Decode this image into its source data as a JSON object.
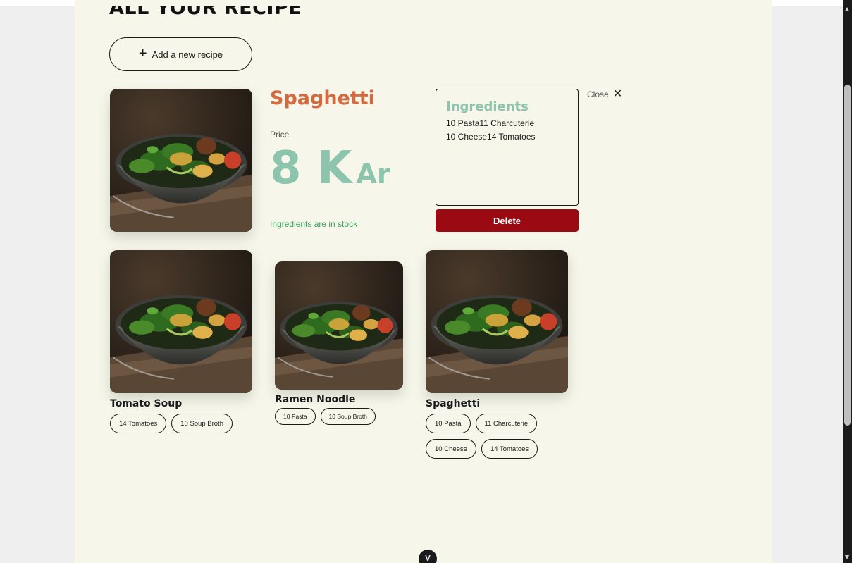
{
  "page": {
    "title": "ALL YOUR RECIPE",
    "add_button_label": "Add a new recipe",
    "add_button_icon": "plus-icon"
  },
  "detail": {
    "name": "Spaghetti",
    "price_label": "Price",
    "price_value": "8 K",
    "price_unit": "Ar",
    "stock_status": "Ingredients are in stock",
    "ingredients_title": "Ingredients",
    "ingredient_lines": [
      "10 Pasta11 Charcuterie",
      "10 Cheese14 Tomatoes"
    ],
    "delete_label": "Delete",
    "close_label": "Close",
    "close_icon": "close-icon"
  },
  "cards": [
    {
      "name": "Tomato Soup",
      "tags": [
        "14 Tomatoes",
        "10 Soup Broth"
      ]
    },
    {
      "name": "Ramen Noodle",
      "tags": [
        "10 Pasta",
        "10 Soup Broth"
      ]
    },
    {
      "name": "Spaghetti",
      "tags": [
        "10 Pasta",
        "11 Charcuterie",
        "10 Cheese",
        "14 Tomatoes"
      ]
    }
  ],
  "scroll_down_glyph": "V",
  "colors": {
    "background": "#f6f7ea",
    "title_orange": "#d46a3f",
    "price_green": "#8cc4ad",
    "stock_green": "#3aa35a",
    "delete_red": "#9b0a12"
  }
}
